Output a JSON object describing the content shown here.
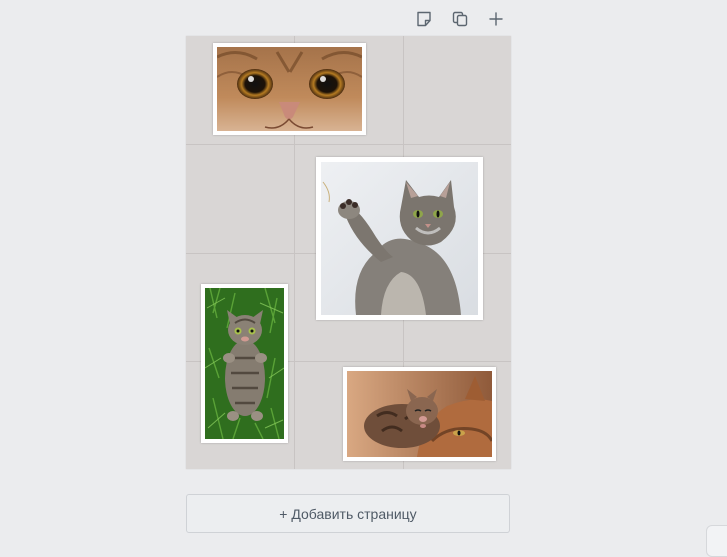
{
  "toolbar": {
    "icons": [
      "note-icon",
      "duplicate-icon",
      "plus-icon"
    ]
  },
  "canvas": {
    "background": "#d9d6d5",
    "grid_color": "#c8c4c3",
    "photos": [
      {
        "name": "cat-eyes-photo",
        "subject": "close-up of cat face with amber eyes"
      },
      {
        "name": "cat-waving-photo",
        "subject": "grey fluffy cat raising paw"
      },
      {
        "name": "kitten-grass-photo",
        "subject": "tabby kitten lying on green grass"
      },
      {
        "name": "cat-kitten-photo",
        "subject": "mother cat with kitten"
      }
    ]
  },
  "add_page": {
    "label": "+ Добавить страницу"
  },
  "colors": {
    "page_bg": "#ebecee",
    "button_text": "#4f5a66"
  }
}
